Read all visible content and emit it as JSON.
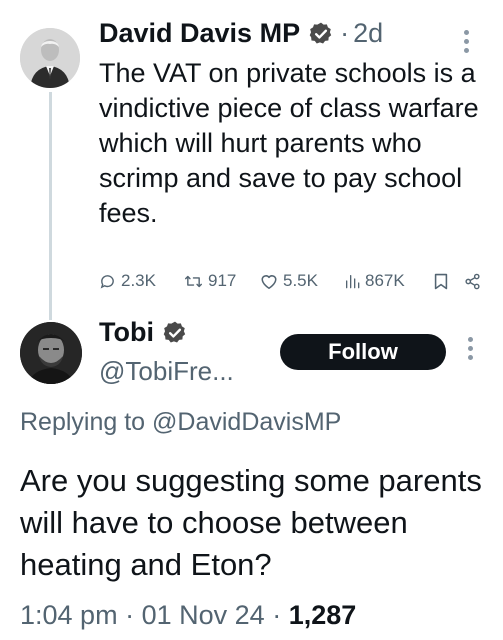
{
  "tweet1": {
    "author_name": "David Davis MP",
    "separator": "·",
    "time": "2d",
    "text": "The VAT on private schools is a vindictive piece of class warfare which will hurt parents who scrimp and save to pay school fees.",
    "stats": {
      "replies": "2.3K",
      "retweets": "917",
      "likes": "5.5K",
      "views": "867K"
    }
  },
  "tweet2": {
    "author_name": "Tobi",
    "handle": "@TobiFre...",
    "follow_label": "Follow",
    "replying_to": "Replying to @DavidDavisMP",
    "text": "Are you suggesting some parents will have to choose between heating and Eton?",
    "time": "1:04 pm",
    "date": "01 Nov 24",
    "views": "1,287",
    "separator": "·"
  },
  "colors": {
    "text": "#0f1419",
    "secondary": "#536471",
    "verified_badge": "#4a4a4a",
    "follow_bg": "#0f1419"
  },
  "icons": [
    "verified-badge-icon",
    "more-icon",
    "reply-icon",
    "retweet-icon",
    "like-icon",
    "views-icon",
    "bookmark-icon",
    "share-icon"
  ]
}
